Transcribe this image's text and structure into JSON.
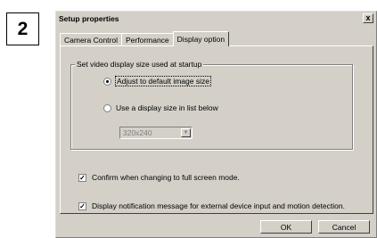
{
  "step_number": "2",
  "dialog": {
    "title": "Setup properties",
    "close_glyph": "x"
  },
  "tabs": [
    {
      "label": "Camera Control",
      "active": false
    },
    {
      "label": "Performance",
      "active": false
    },
    {
      "label": "Display option",
      "active": true
    }
  ],
  "display_group": {
    "legend": "Set video display size used at startup",
    "options": [
      {
        "label": "Adjust to default image size",
        "selected": true
      },
      {
        "label": "Use a display size in list below",
        "selected": false
      }
    ],
    "size_select": {
      "value": "320x240",
      "enabled": false,
      "arrow_glyph": "▼"
    }
  },
  "checkboxes": [
    {
      "label": "Confirm when changing to full screen mode.",
      "checked": true
    },
    {
      "label": "Display notification message for external device input and motion detection.",
      "checked": true
    }
  ],
  "buttons": {
    "ok": "OK",
    "cancel": "Cancel"
  },
  "check_glyph": "✓"
}
